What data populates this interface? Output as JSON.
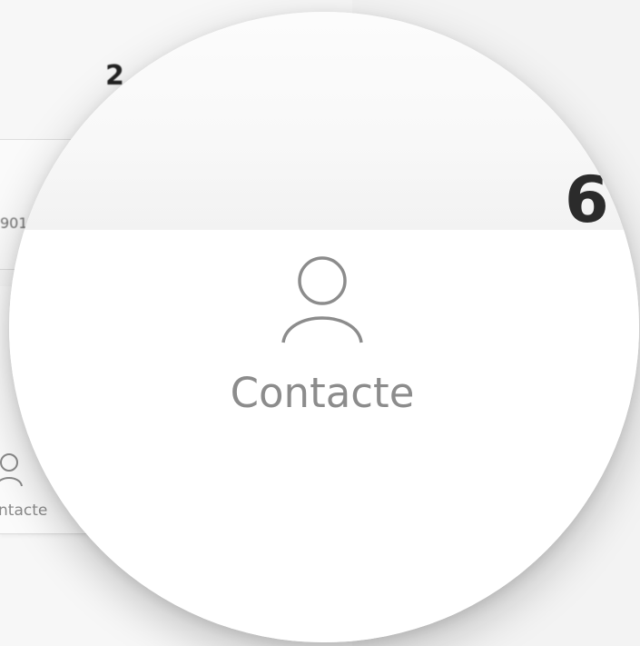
{
  "background": {
    "header_number": "2",
    "card_number": "901",
    "contact_label": "ntacte"
  },
  "magnifier": {
    "big_number": "6",
    "contact_label": "Contacte",
    "contact_icon": "person-icon"
  }
}
